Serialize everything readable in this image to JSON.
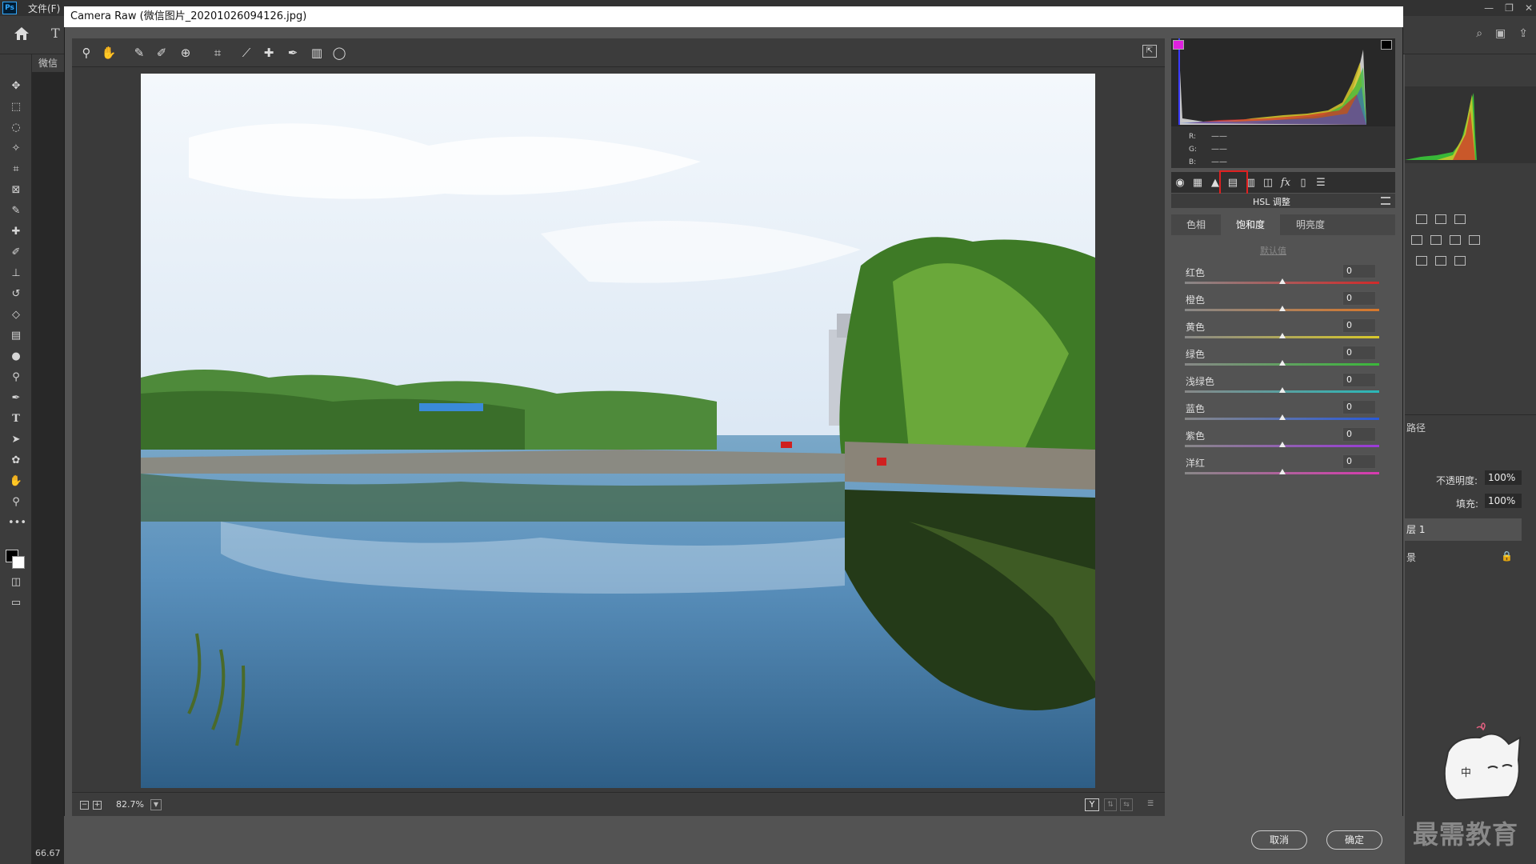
{
  "app": {
    "menu": [
      "文件(F)"
    ],
    "doc_tab": "微信",
    "zoom_status": "66.67"
  },
  "layers": {
    "paths_tab": "路径",
    "opacity_label": "不透明度:",
    "opacity_value": "100%",
    "fill_label": "填充:",
    "fill_value": "100%",
    "layer1": "层 1",
    "background": "景"
  },
  "watermark": "最需教育",
  "mascot_text": "中",
  "camera_raw": {
    "title": "Camera Raw (微信图片_20201026094126.jpg)",
    "zoom_value": "82.7%",
    "view_mode": "Y",
    "rgb": {
      "r_label": "R:",
      "g_label": "G:",
      "b_label": "B:",
      "r_value": "——",
      "g_value": "——",
      "b_value": "——"
    },
    "panel_title": "HSL 调整",
    "subtabs": [
      "色相",
      "饱和度",
      "明亮度"
    ],
    "active_subtab": 1,
    "defaults_label": "默认值",
    "sliders": [
      {
        "label": "红色",
        "value": "0",
        "amount": 0
      },
      {
        "label": "橙色",
        "value": "0",
        "amount": 0
      },
      {
        "label": "黄色",
        "value": "0",
        "amount": 0
      },
      {
        "label": "绿色",
        "value": "0",
        "amount": 0
      },
      {
        "label": "浅绿色",
        "value": "0",
        "amount": 0
      },
      {
        "label": "蓝色",
        "value": "0",
        "amount": 0
      },
      {
        "label": "紫色",
        "value": "0",
        "amount": 0
      },
      {
        "label": "洋红",
        "value": "0",
        "amount": 0
      }
    ],
    "cancel_label": "取消",
    "ok_label": "确定"
  },
  "colors": {
    "accent_highlight": "#e02020",
    "tracks": [
      [
        "#d02a2a",
        "#888888"
      ],
      [
        "#d8782a",
        "#888888"
      ],
      [
        "#d8c82a",
        "#888888"
      ],
      [
        "#3ab83a",
        "#888888"
      ],
      [
        "#2ab8b8",
        "#888888"
      ],
      [
        "#2a5ad8",
        "#888888"
      ],
      [
        "#9a3ad8",
        "#888888"
      ],
      [
        "#d83ab0",
        "#888888"
      ]
    ]
  }
}
